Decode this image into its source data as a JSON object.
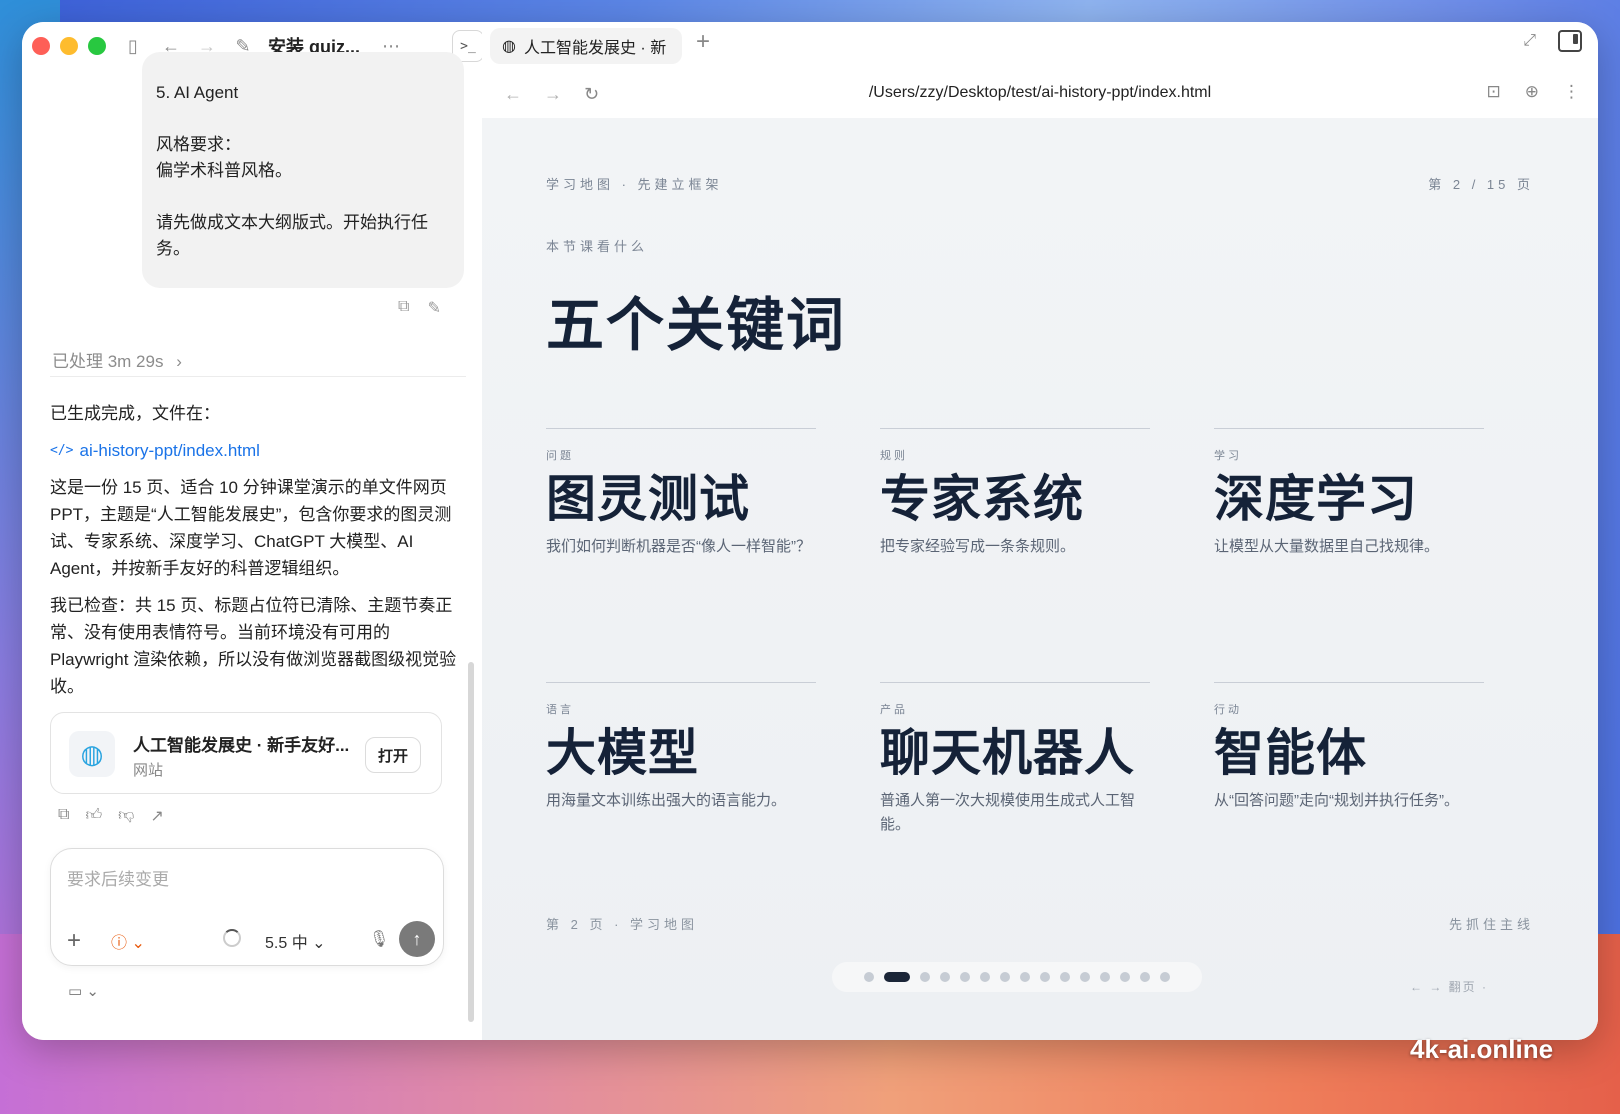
{
  "left": {
    "doc_title": "安装 guiz...",
    "user_bubble": {
      "lines": [
        "5. AI Agent",
        "",
        "风格要求：",
        "偏学术科普风格。",
        "",
        "请先做成文本大纲版式。开始执行任务。"
      ]
    },
    "processed_label": "已处理 3m 29s",
    "answer": {
      "intro": "已生成完成，文件在：",
      "file_link": "ai-history-ppt/index.html",
      "para1": "这是一份 15 页、适合 10 分钟课堂演示的单文件网页 PPT，主题是“人工智能发展史”，包含你要求的图灵测试、专家系统、深度学习、ChatGPT 大模型、AI Agent，并按新手友好的科普逻辑组织。",
      "para2": "我已检查：共 15 页、标题占位符已清除、主题节奏正常、没有使用表情符号。当前环境没有可用的 Playwright 渲染依赖，所以没有做浏览器截图级视觉验收。"
    },
    "card": {
      "title": "人工智能发展史 · 新手友好...",
      "subtitle": "网站",
      "open_label": "打开"
    },
    "composer": {
      "placeholder": "要求后续变更",
      "model_label": "5.5 中"
    }
  },
  "browser": {
    "tab_title": "人工智能发展史 · 新",
    "url": "/Users/zzy/Desktop/test/ai-history-ppt/index.html"
  },
  "slide": {
    "section": "学习地图 · 先建立框架",
    "page_indicator": "第 2 / 15 页",
    "kicker": "本节课看什么",
    "title": "五个关键词",
    "keywords": [
      {
        "tag": "问题",
        "name": "图灵测试",
        "desc": "我们如何判断机器是否“像人一样智能”？"
      },
      {
        "tag": "规则",
        "name": "专家系统",
        "desc": "把专家经验写成一条条规则。"
      },
      {
        "tag": "学习",
        "name": "深度学习",
        "desc": "让模型从大量数据里自己找规律。"
      },
      {
        "tag": "语言",
        "name": "大模型",
        "desc": "用海量文本训练出强大的语言能力。"
      },
      {
        "tag": "产品",
        "name": "聊天机器人",
        "desc": "普通人第一次大规模使用生成式人工智能。"
      },
      {
        "tag": "行动",
        "name": "智能体",
        "desc": "从“回答问题”走向“规划并执行任务”。"
      }
    ],
    "footer_left": "第 2 页 · 学习地图",
    "footer_right": "先抓住主线",
    "keys_hint": "← → 翻页 ·",
    "pager": {
      "total": 15,
      "current": 2
    }
  },
  "watermark": "4k-ai.online"
}
